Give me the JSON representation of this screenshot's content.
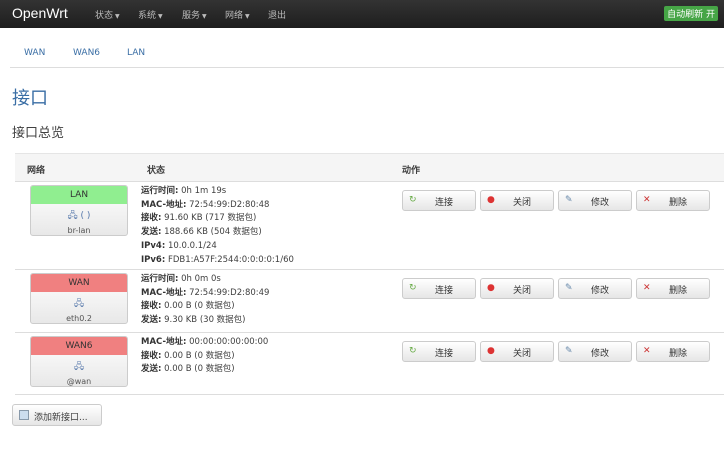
{
  "nav": {
    "brand": "OpenWrt",
    "menus": [
      "状态",
      "系统",
      "服务",
      "网络",
      "退出"
    ],
    "autorefresh": "自动刷新 开"
  },
  "tabs": [
    "WAN",
    "WAN6",
    "LAN"
  ],
  "title": "接口",
  "subtitle": "接口总览",
  "table": {
    "headers": [
      "网络",
      "状态",
      "动作"
    ],
    "rows": [
      {
        "name": "LAN",
        "color": "#90ee90",
        "icon": "(  )",
        "device": "br-lan",
        "lines": [
          [
            "运行时间:",
            "0h 1m 19s"
          ],
          [
            "MAC-地址:",
            "72:54:99:D2:80:48"
          ],
          [
            "接收:",
            "91.60 KB (717 数据包)"
          ],
          [
            "发送:",
            "188.66 KB (504 数据包)"
          ],
          [
            "IPv4:",
            "10.0.0.1/24"
          ],
          [
            "IPv6:",
            "FDB1:A57F:2544:0:0:0:0:1/60"
          ]
        ]
      },
      {
        "name": "WAN",
        "color": "#f08080",
        "icon": "",
        "device": "eth0.2",
        "lines": [
          [
            "运行时间:",
            "0h 0m 0s"
          ],
          [
            "MAC-地址:",
            "72:54:99:D2:80:49"
          ],
          [
            "接收:",
            "0.00 B (0 数据包)"
          ],
          [
            "发送:",
            "9.30 KB (30 数据包)"
          ]
        ]
      },
      {
        "name": "WAN6",
        "color": "#f08080",
        "icon": "",
        "device": "@wan",
        "lines": [
          [
            "MAC-地址:",
            "00:00:00:00:00:00"
          ],
          [
            "接收:",
            "0.00 B (0 数据包)"
          ],
          [
            "发送:",
            "0.00 B (0 数据包)"
          ]
        ]
      }
    ]
  },
  "actions": [
    "连接",
    "关闭",
    "修改",
    "删除"
  ],
  "add_button": "添加新接口..."
}
